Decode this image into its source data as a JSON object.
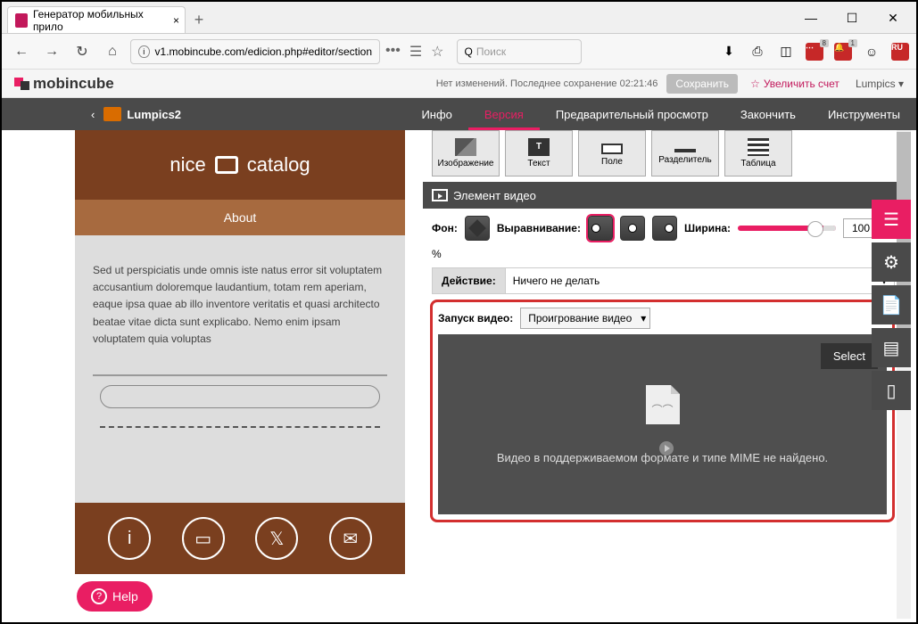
{
  "browser": {
    "tab_title": "Генератор мобильных прило",
    "tab_close": "×",
    "new_tab": "+",
    "url": "v1.mobincube.com/edicion.php#editor/section",
    "search_placeholder": "Поиск",
    "win_min": "—",
    "win_max": "☐",
    "win_close": "✕",
    "badge1": "8",
    "badge2": "1",
    "ru": "RU"
  },
  "header": {
    "logo": "mobincube",
    "status": "Нет изменений. Последнее сохранение 02:21:46",
    "save": "Сохранить",
    "upgrade": "Увеличить счет",
    "star": "☆",
    "user": "Lumpics",
    "chevron": "▾"
  },
  "darkbar": {
    "back": "‹",
    "app_name": "Lumpics2",
    "nav": [
      "Инфо",
      "Версия",
      "Предварительный просмотр",
      "Закончить",
      "Инструменты"
    ]
  },
  "preview": {
    "title_left": "nice",
    "title_right": "catalog",
    "about": "About",
    "lorem": "Sed ut perspiciatis unde omnis iste natus error sit voluptatem accusantium doloremque laudantium, totam rem aperiam, eaque ipsa quae ab illo inventore veritatis et quasi architecto beatae vitae dicta sunt explicabo. Nemo enim ipsam voluptatem quia voluptas"
  },
  "tools": {
    "items": [
      "Изображение",
      "Текст",
      "Поле",
      "Разделитель",
      "Таблица"
    ]
  },
  "section": {
    "title": "Элемент видео"
  },
  "props": {
    "bg_label": "Фон:",
    "align_label": "Выравнивание:",
    "width_label": "Ширина:",
    "width_value": "100",
    "width_unit": "%",
    "action_label": "Действие:",
    "action_value": "Ничего не делать",
    "action_chevron": "▾"
  },
  "video": {
    "launch_label": "Запуск видео:",
    "launch_value": "Проигрование видео",
    "select_btn": "Select",
    "error_msg": "Видео в поддерживаемом формате и типе MIME не найдено.",
    "sad": "⌒⌒"
  },
  "help": {
    "label": "Help",
    "q": "?"
  }
}
